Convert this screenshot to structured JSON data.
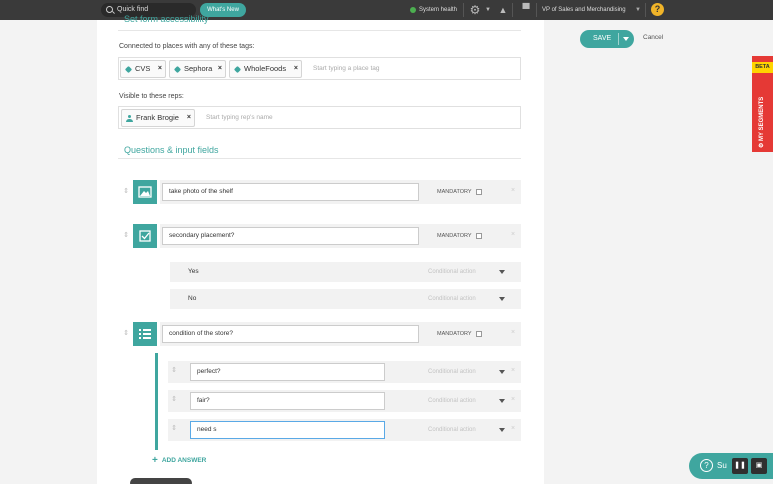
{
  "topbar": {
    "quickfind_placeholder": "Quick find",
    "whats_new": "What's New",
    "system_health": "System health",
    "role": "VP of Sales and Merchandising",
    "role_caret": "▼",
    "help": "?"
  },
  "form": {
    "section_title": "Set form accessibility",
    "places_label": "Connected to places with any of these tags:",
    "place_tags": [
      "CVS",
      "Sephora",
      "WholeFoods"
    ],
    "place_placeholder": "Start typing a place tag",
    "reps_label": "Visible to these reps:",
    "reps": [
      "Frank Brogie"
    ],
    "rep_placeholder": "Start typing rep's name",
    "chip_remove": "×",
    "questions_title": "Questions & input fields"
  },
  "questions": [
    {
      "type_icon": "image-icon",
      "text": "take photo of the shelf",
      "mandatory_label": "MANDATORY",
      "mandatory": false
    },
    {
      "type_icon": "checkbox-icon",
      "text": "secondary placement?",
      "mandatory_label": "MANDATORY",
      "mandatory": false,
      "options": [
        {
          "label": "Yes",
          "action": "Conditional action"
        },
        {
          "label": "No",
          "action": "Conditional action"
        }
      ]
    },
    {
      "type_icon": "list-icon",
      "text": "condition of the store?",
      "mandatory_label": "MANDATORY",
      "mandatory": false,
      "answers": [
        {
          "value": "perfect?",
          "action": "Conditional action"
        },
        {
          "value": "fair?",
          "action": "Conditional action"
        },
        {
          "value": "need s",
          "action": "Conditional action"
        }
      ]
    }
  ],
  "add_answer": "ADD ANSWER",
  "actions": {
    "save": "SAVE",
    "cancel": "Cancel"
  },
  "side": {
    "beta": "BETA",
    "segments": "MY SEGMENTS"
  },
  "support": {
    "label": "Su"
  },
  "colors": {
    "accent": "#3fa69f",
    "segments": "#e53935",
    "beta": "#ffd400",
    "topbar": "#3a3a3a"
  }
}
